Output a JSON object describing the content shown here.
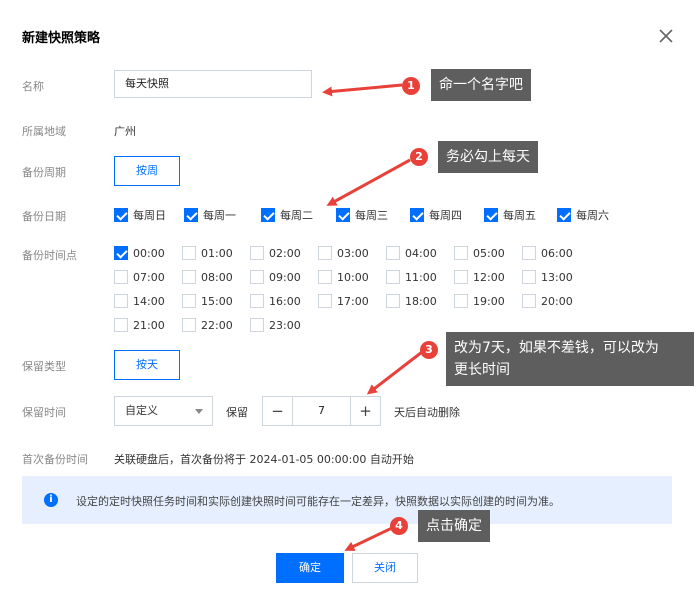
{
  "dialog": {
    "title": "新建快照策略",
    "close_icon": "close-icon"
  },
  "form": {
    "name_label": "名称",
    "name_value": "每天快照",
    "region_label": "所属地域",
    "region_value": "广州",
    "cycle_label": "备份周期",
    "cycle_value": "按周",
    "date_label": "备份日期",
    "days": [
      {
        "label": "每周日",
        "checked": true
      },
      {
        "label": "每周一",
        "checked": true
      },
      {
        "label": "每周二",
        "checked": true
      },
      {
        "label": "每周三",
        "checked": true
      },
      {
        "label": "每周四",
        "checked": true
      },
      {
        "label": "每周五",
        "checked": true
      },
      {
        "label": "每周六",
        "checked": true
      }
    ],
    "time_label": "备份时间点",
    "times": [
      {
        "label": "00:00",
        "checked": true
      },
      {
        "label": "01:00",
        "checked": false
      },
      {
        "label": "02:00",
        "checked": false
      },
      {
        "label": "03:00",
        "checked": false
      },
      {
        "label": "04:00",
        "checked": false
      },
      {
        "label": "05:00",
        "checked": false
      },
      {
        "label": "06:00",
        "checked": false
      },
      {
        "label": "07:00",
        "checked": false
      },
      {
        "label": "08:00",
        "checked": false
      },
      {
        "label": "09:00",
        "checked": false
      },
      {
        "label": "10:00",
        "checked": false
      },
      {
        "label": "11:00",
        "checked": false
      },
      {
        "label": "12:00",
        "checked": false
      },
      {
        "label": "13:00",
        "checked": false
      },
      {
        "label": "14:00",
        "checked": false
      },
      {
        "label": "15:00",
        "checked": false
      },
      {
        "label": "16:00",
        "checked": false
      },
      {
        "label": "17:00",
        "checked": false
      },
      {
        "label": "18:00",
        "checked": false
      },
      {
        "label": "19:00",
        "checked": false
      },
      {
        "label": "20:00",
        "checked": false
      },
      {
        "label": "21:00",
        "checked": false
      },
      {
        "label": "22:00",
        "checked": false
      },
      {
        "label": "23:00",
        "checked": false
      }
    ],
    "retention_type_label": "保留类型",
    "retention_type_value": "按天",
    "retention_time_label": "保留时间",
    "retention_mode": "自定义",
    "keep_label": "保留",
    "stepper_minus": "−",
    "stepper_value": "7",
    "stepper_plus": "+",
    "after_label": "天后自动删除",
    "first_backup_label": "首次备份时间",
    "first_backup_value": "关联硬盘后，首次备份将于 2024-01-05 00:00:00 自动开始"
  },
  "notice": {
    "icon": "info-icon",
    "icon_glyph": "i",
    "text": "设定的定时快照任务时间和实际创建快照时间可能存在一定差异，快照数据以实际创建的时间为准。"
  },
  "footer": {
    "ok_label": "确定",
    "close_label": "关闭"
  },
  "annotations": [
    {
      "num": "1",
      "text": "命一个名字吧"
    },
    {
      "num": "2",
      "text": "务必勾上每天"
    },
    {
      "num": "3",
      "text_line1": "改为7天，如果不差钱，可以改为",
      "text_line2": "更长时间"
    },
    {
      "num": "4",
      "text": "点击确定"
    }
  ],
  "colors": {
    "primary": "#006eff",
    "annotation_red": "#e8413a",
    "tooltip_gray": "#5e5e5e"
  }
}
